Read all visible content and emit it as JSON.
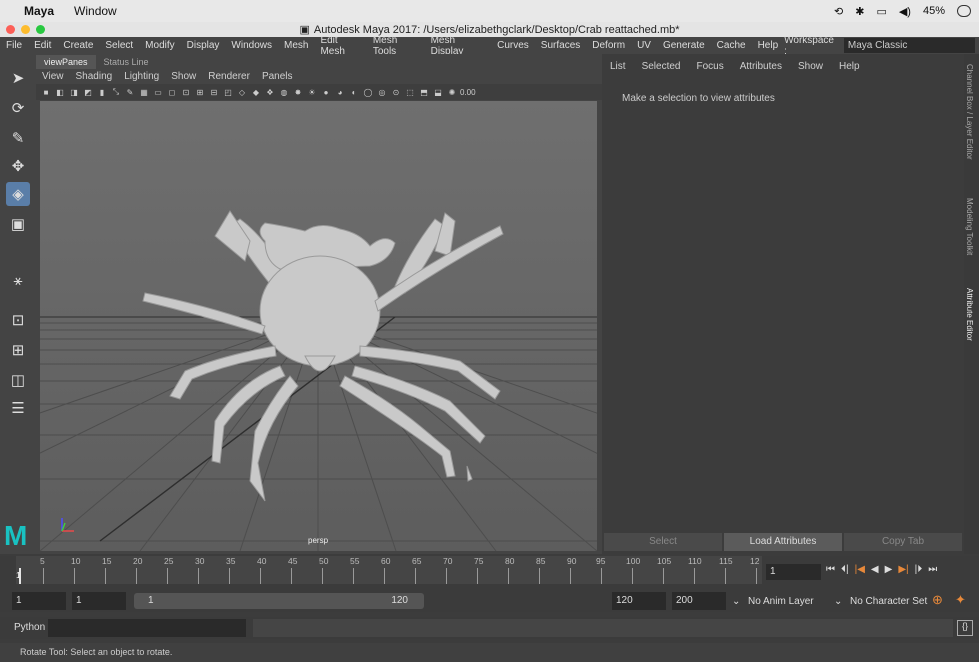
{
  "macbar": {
    "app": "Maya",
    "menu": [
      "Window"
    ],
    "battery": "45%"
  },
  "window": {
    "title": "Autodesk Maya 2017: /Users/elizabethgclark/Desktop/Crab reattached.mb*"
  },
  "menubar": {
    "items": [
      "File",
      "Edit",
      "Create",
      "Select",
      "Modify",
      "Display",
      "Windows",
      "Mesh",
      "Edit Mesh",
      "Mesh Tools",
      "Mesh Display",
      "Curves",
      "Surfaces",
      "Deform",
      "UV",
      "Generate",
      "Cache",
      "Help"
    ],
    "workspace_label": "Workspace :",
    "workspace_value": "Maya Classic"
  },
  "panel": {
    "tabs": [
      "viewPanes",
      "Status Line"
    ],
    "menu": [
      "View",
      "Shading",
      "Lighting",
      "Show",
      "Renderer",
      "Panels"
    ],
    "toolbar_value": "0.00",
    "camera_label": "persp"
  },
  "attribute_editor": {
    "menu": [
      "List",
      "Selected",
      "Focus",
      "Attributes",
      "Show",
      "Help"
    ],
    "message": "Make a selection to view attributes",
    "buttons": [
      "Select",
      "Load Attributes",
      "Copy Tab"
    ]
  },
  "side_tabs": [
    "Channel Box / Layer Editor",
    "Modeling Toolkit",
    "Attribute Editor"
  ],
  "timeline": {
    "ticks": [
      "1",
      "5",
      "10",
      "15",
      "20",
      "25",
      "30",
      "35",
      "40",
      "45",
      "50",
      "55",
      "60",
      "65",
      "70",
      "75",
      "80",
      "85",
      "90",
      "95",
      "100",
      "105",
      "110",
      "115",
      "12"
    ],
    "current_frame": "1"
  },
  "range": {
    "start": "1",
    "playback_start": "1",
    "slider_start": "1",
    "slider_end": "120",
    "playback_end": "120",
    "end": "200",
    "anim_layer": "No Anim Layer",
    "character_set": "No Character Set"
  },
  "command": {
    "label": "Python"
  },
  "help_line": "Rotate Tool: Select an object to rotate."
}
